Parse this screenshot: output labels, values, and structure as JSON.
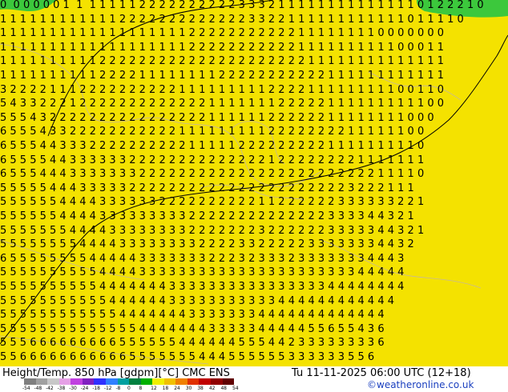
{
  "map": {
    "rows": [
      "0  0 0 0 0 0 1  1  1 1 1 1 1 2 2 2 2 2 2 2 2 2 2 3 3 3 2 1 1 1 1 1 1 1 1 1 1 1 1 1 1 0 1 2 2 2 1 0",
      "1 1 1 1 1 1 1 1 1 1 1 1 2 2 2 2 2 2 2 2 2 2 2 2 2 3 3 2 2 1 1 1 1 1 1 1 1 1 1 1 1 0 1 1 1 1 0",
      "1 1 1 1 1 1 1 1 1 1 1 1 1 1 1 1 1 1 1 2 2 2 2 2 2 2 2 2 2 2 1 1 1 1 1 1 1 1 0 0 0 0 0 0 0",
      "1 1 1 1 1 1 1 1 1 1 1 1 1 1 1 1 1 1 1 2 2 2 2 2 2 2 2 2 2 2 1 1 1 1 1 1 1 1 1 1 0 0 0 1 1",
      "1 1 1 1 1 1 1 1 1 1 2 2 2 2 2 2 2 2 2 2 2 2 2 2 2 2 2 2 2 2 2 1 1 1 1 1 1 1 1 1 1 1 1 1 1",
      "1 1 1 1 1 1 1 1 1 1 2 2 2 2 1 1 1 1 1 1 1 1 2 2 2 2 2 2 2 2 2 2 2 1 1 1 1 1 1 1 1 1 1 1 1",
      "3 2 2 2 2 1 1 1 2 2 2 2 2 2 2 2 2 2 1 1 1 1 1 1 1 1 1 2 2 2 2 1 1 1 1 1 1 1 1 1 0 0 1 1 0",
      "5 4 3 3 2 2 2 1 2 2 2 2 2 2 2 2 2 2 2 2 2 1 1 1 1 1 1 1 2 2 2 2 2 1 1 1 1 1 1 1 1 1 1 0 0",
      "5 5 5 4 3 2 2 2 2 2 2 2 2 2 2 2 2 2 2 2 2 1 1 1 1 1 1 2 2 2 2 2 2 1 1 1 1 1 1 1 1 0 0 0",
      "6 5 5 5 4 3 3 2 2 2 2 2 2 2 2 2 2 2 1 1 1 1 1 1 1 1 1 2 2 2 2 2 2 2 2 1 1 1 1 1 1 0 0",
      "6 5 5 5 4 4 3 3 3 2 2 2 2 2 2 2 2 2 2 1 1 1 1 1 2 2 2 2 2 2 2 2 2 1 1 1 1 1 1 1 1 1 0",
      "6 5 5 5 5 4 4 3 3 3 3 3 3 2 2 2 2 2 2 2 2 2 2 2 2 2 2 1 2 2 2 2 2 2 2 2 1 1 1 1 1 1 1",
      "6 5 5 5 4 4 4 3 3 3 3 3 3 3 2 2 2 2 2 2 2 2 2 2 2 2 2 2 2 2 2 2 2 2 2 2 2 2 1 1 1 1 0",
      "5 5 5 5 5 4 4 4 3 3 3 3 3 2 2 2 2 2 2 2 2 2 2 2 2 2 2 2 2 2 2 2 2 2 2 3 2 2 2 1 1 1",
      "5 5 5 5 5 5 4 4 4 4 3 3 3 3 3 3 2 2 2 2 2 2 2 2 2 2 1 1 2 2 2 2 2 2 3 3 3 3 3 3 2 2 1",
      "5 5 5 5 5 5 4 4 4 4 3 3 3 3 3 3 3 3 3 2 2 2 2 2 2 2 2 2 2 2 2 2 2 3 3 3 3 4 4 3 2 1",
      "5 5 5 5 5 5 5 4 4 4 4 3 3 3 3 3 3 3 3 2 2 2 2 2 2 2 3 2 2 2 2 2 2 3 3 3 3 3 4 4 3 2 1",
      "5 5 5 5 5 5 5 5 4 4 4 4 3 3 3 3 3 3 3 3 2 2 2 2 3 3 2 2 2 2 2 3 3 3 3 3 3 3 4 4 3 2",
      "6 5 5 5 5 5 5 5 5 4 4 4 4 4 3 3 3 3 3 3 3 2 2 2 3 2 3 3 3 2 3 3 3 3 3 3 3 4 4 4 3",
      "5 5 5 5 5 5 5 5 5 5 4 4 4 4 3 3 3 3 3 3 3 3 3 3 3 3 3 3 3 3 3 3 3 3 3 3 4 4 4 4 4",
      "5 5 5 5 5 5 5 5 5 5 4 4 4 4 4 4 4 3 3 3 3 3 3 3 3 3 3 3 3 3 3 3 3 4 4 4 4 4 4 4 4",
      "5 5 5 5 5 5 5 5 5 5 5 4 4 4 4 4 4 3 3 3 3 3 3 3 3 3 3 3 4 4 4 4 4 4 4 4 4 4 4 4",
      "5 5 5 5 5 5 5 5 5 5 5 5 4 4 4 4 4 4 4 3 3 3 3 3 3 3 4 4 4 4 4 4 4 4 4 4 4 4 4",
      "5 5 5 5 5 5 5 5 5 5 5 5 5 5 4 4 4 4 4 4 4 3 3 3 3 3 4 4 4 4 4 5 5 6 5 5 4 3 6",
      "5 5 5 6 6 6 6 6 6 6 6 6 5 5 5 5 5 5 4 4 4 4 4 4 5 5 5 4 4 2 3 3 3 3 3 3 3 3 6",
      "5 5 6 6 6 6 6 6 6 6 6 6 6 5 5 5 5 5 5 5 4 4 4 5 5 5 5 5 5 3 3 3 3 3 3 5 5 6"
    ]
  },
  "footer": {
    "title": "Height/Temp. 850 hPa [gdpm][°C] CMC ENS",
    "datetime": "Tu 11-11-2025 06:00 UTC (12+18)",
    "credit": "©weatheronline.co.uk",
    "colorbar_labels": [
      "-54",
      "-48",
      "-42",
      "-38",
      "-30",
      "-24",
      "-18",
      "-12",
      "-8",
      "0",
      "8",
      "12",
      "18",
      "24",
      "30",
      "38",
      "42",
      "48",
      "54"
    ],
    "colorbar_colors": [
      "#7f7f7f",
      "#a0a0a0",
      "#c8c8c8",
      "#e6a0e6",
      "#c040e0",
      "#8020c0",
      "#3030ff",
      "#3080ff",
      "#00a0a0",
      "#008040",
      "#00b000",
      "#f0f000",
      "#f0c000",
      "#f08000",
      "#e03000",
      "#c00000",
      "#900000",
      "#600000"
    ]
  }
}
